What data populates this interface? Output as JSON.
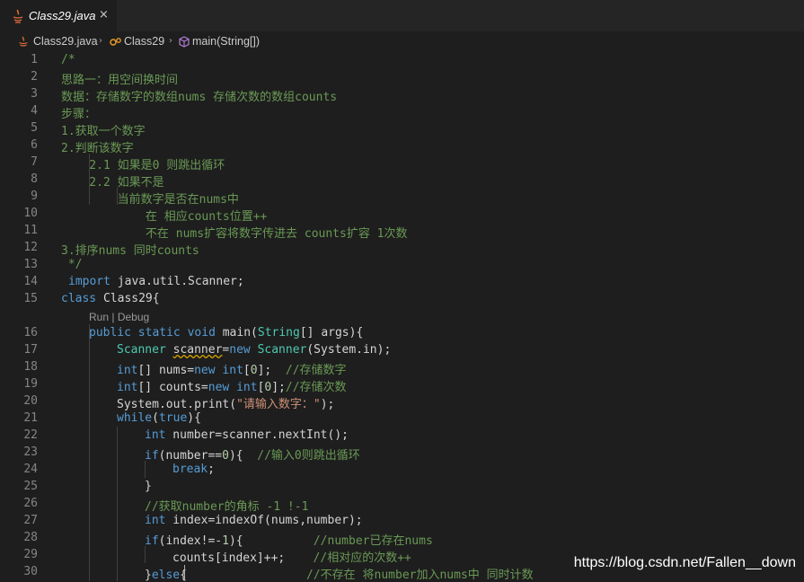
{
  "tab": {
    "title": "Class29.java",
    "close_symbol": "×",
    "icon": "java-file-icon"
  },
  "breadcrumb": {
    "file": "Class29.java",
    "class": "Class29",
    "method": "main(String[])",
    "separator": "›"
  },
  "codelens": {
    "run": "Run",
    "divider": " | ",
    "debug": "Debug"
  },
  "line_numbers": [
    "1",
    "2",
    "3",
    "4",
    "5",
    "6",
    "7",
    "8",
    "9",
    "10",
    "11",
    "12",
    "13",
    "14",
    "15",
    "16",
    "17",
    "18",
    "19",
    "20",
    "21",
    "22",
    "23",
    "24",
    "25",
    "26",
    "27",
    "28",
    "29",
    "30"
  ],
  "code": {
    "l1": "/*",
    "l2": "思路一：用空间换时间",
    "l3": "数据：存储数字的数组nums 存储次数的数组counts",
    "l4": "步骤：",
    "l5": "1.获取一个数字",
    "l6": "2.判断该数字",
    "l7": "    2.1 如果是0 则跳出循环",
    "l8": "    2.2 如果不是",
    "l9": "        当前数字是否在nums中",
    "l10": "            在 相应counts位置++",
    "l11": "            不在 nums扩容将数字传进去 counts扩容 1次数",
    "l12": "3.排序nums 同时counts",
    "l13": " */",
    "l14_kw": "import",
    "l14_rest": " java.util.Scanner;",
    "l15_kw": "class",
    "l15_rest": " Class29{",
    "l16": {
      "kw1": "public",
      "kw2": "static",
      "kw3": "void",
      "fn": "main",
      "p1": "(",
      "t": "String",
      "p2": "[] ",
      "v": "args",
      "p3": "){"
    },
    "l17": {
      "t1": "Scanner",
      "v": "scanner",
      "eq": "=",
      "kw": "new",
      "t2": "Scanner",
      "rest": "(System.in);"
    },
    "l18": {
      "kw": "int",
      "a": "[] nums=",
      "kw2": "new",
      "kw3": "int",
      "b": "[",
      "n": "0",
      "c": "];  ",
      "cm": "//存储数字"
    },
    "l19": {
      "kw": "int",
      "a": "[] counts=",
      "kw2": "new",
      "kw3": "int",
      "b": "[",
      "n": "0",
      "c": "];",
      "cm": "//存储次数"
    },
    "l20": {
      "a": "System.out.print(",
      "s": "\"请输入数字：\"",
      "b": ");"
    },
    "l21": {
      "kw": "while",
      "a": "(",
      "kw2": "true",
      "b": "){"
    },
    "l22": {
      "kw": "int",
      "a": " number=scanner.nextInt();"
    },
    "l23": {
      "kw": "if",
      "a": "(number==",
      "n": "0",
      "b": "){  ",
      "cm": "//输入0则跳出循环"
    },
    "l24": {
      "kw": "break",
      "a": ";"
    },
    "l25": "}",
    "l26": "//获取number的角标 -1 !-1",
    "l27": {
      "kw": "int",
      "a": " index=indexOf(nums,number);"
    },
    "l28": {
      "kw": "if",
      "a": "(index!=-",
      "n": "1",
      "b": "){          ",
      "cm": "//number已存在nums"
    },
    "l29": {
      "a": "counts[index]++;    ",
      "cm": "//相对应的次数++"
    },
    "l30": {
      "a": "}",
      "kw": "else",
      "b": "{                 ",
      "cm": "//不存在 将number加入nums中 同时计数"
    }
  },
  "watermark": "https://blog.csdn.net/Fallen__down",
  "colors": {
    "background": "#1e1e1e",
    "comment": "#6a9955",
    "keyword": "#569cd6",
    "type": "#4ec9b0",
    "string": "#ce9178",
    "number": "#b5cea8",
    "line_number": "#858585"
  }
}
